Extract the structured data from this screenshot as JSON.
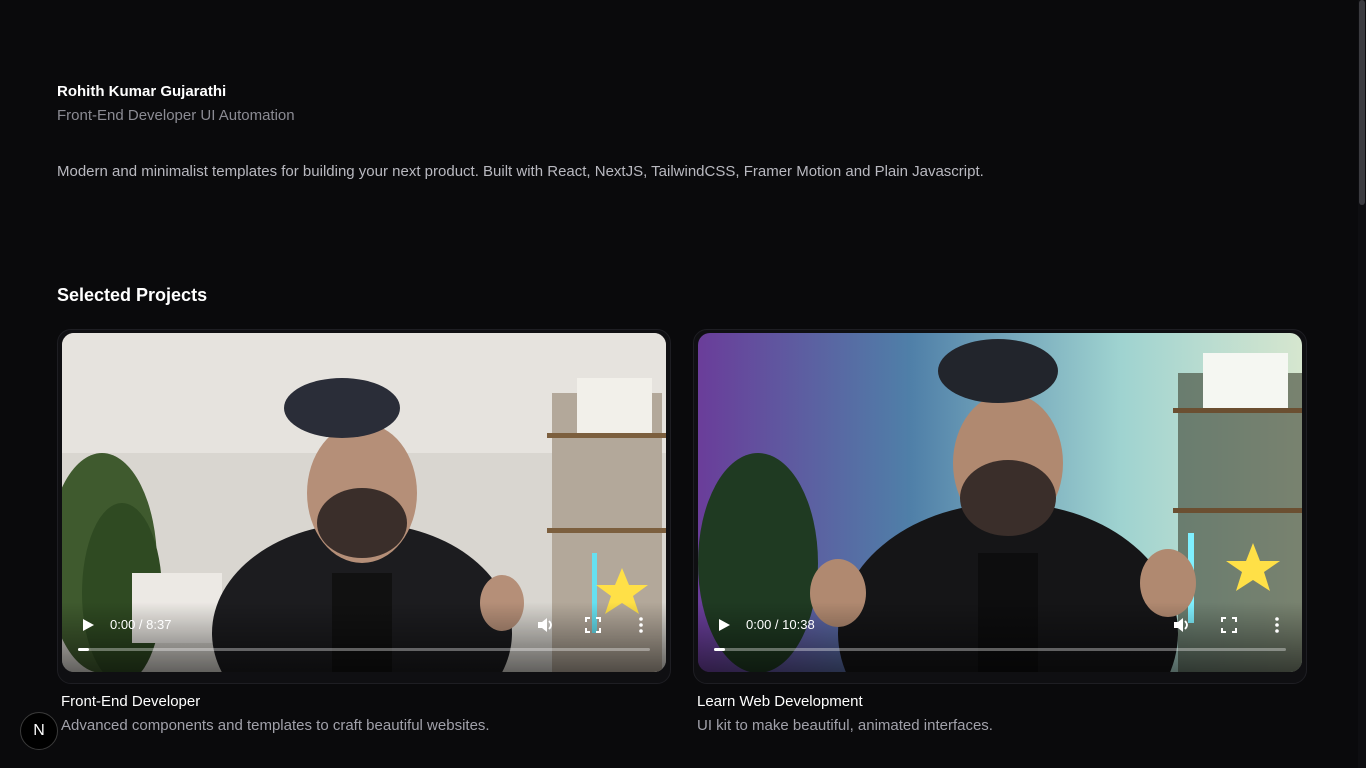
{
  "profile": {
    "name": "Rohith Kumar Gujarathi",
    "role": "Front-End Developer UI Automation",
    "intro": "Modern and minimalist templates for building your next product. Built with React, NextJS, TailwindCSS, Framer Motion and Plain Javascript."
  },
  "projects": {
    "heading": "Selected Projects",
    "items": [
      {
        "title": "Front-End Developer",
        "description": "Advanced components and templates to craft beautiful websites.",
        "time": "0:00 / 8:37",
        "progress": 0.02
      },
      {
        "title": "Learn Web Development",
        "description": "UI kit to make beautiful, animated interfaces.",
        "time": "0:00 / 10:38",
        "progress": 0.02
      }
    ]
  },
  "badge": {
    "letter": "N"
  },
  "icons": [
    "play-icon",
    "volume-icon",
    "fullscreen-icon",
    "more-options-icon"
  ],
  "colors": {
    "background": "#0a0a0c",
    "muted": "#8b8b93",
    "text": "#ffffff"
  }
}
